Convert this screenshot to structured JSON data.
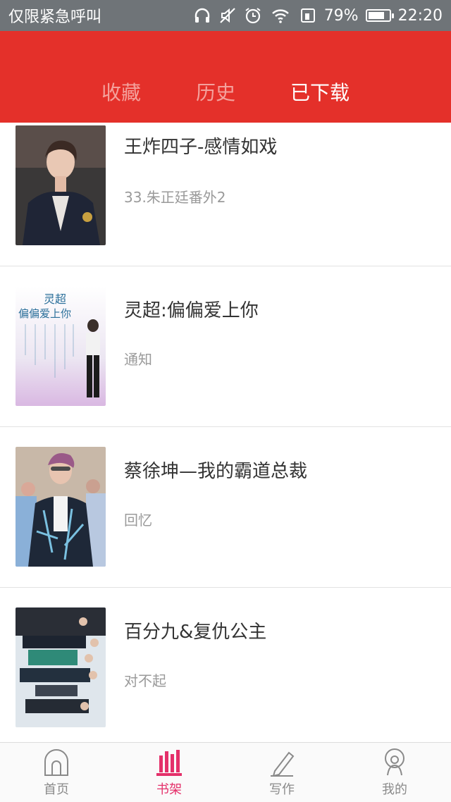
{
  "status_bar": {
    "carrier": "仅限紧急呼叫",
    "battery_pct": "79%",
    "time": "22:20",
    "battery_level": 0.79,
    "icons": [
      "headphones-icon",
      "mute-icon",
      "alarm-icon",
      "wifi-icon",
      "sim-icon",
      "battery-icon"
    ]
  },
  "header": {
    "bg_color": "#e4302a",
    "tabs": [
      {
        "label": "收藏",
        "active": false
      },
      {
        "label": "历史",
        "active": false
      },
      {
        "label": "已下载",
        "active": true
      }
    ]
  },
  "books": [
    {
      "title": "王炸四子-感情如戏",
      "subtitle": "33.朱正廷番外2"
    },
    {
      "title": "灵超:偏偏爱上你",
      "subtitle": "通知",
      "cover_text": [
        "灵超",
        "偏偏爱上你"
      ]
    },
    {
      "title": "蔡徐坤—我的霸道总裁",
      "subtitle": "回忆"
    },
    {
      "title": "百分九&复仇公主",
      "subtitle": "对不起"
    }
  ],
  "bottom_nav": {
    "accent": "#e4306a",
    "items": [
      {
        "label": "首页",
        "icon": "home-arch-icon",
        "active": false
      },
      {
        "label": "书架",
        "icon": "bookshelf-icon",
        "active": true
      },
      {
        "label": "写作",
        "icon": "pencil-icon",
        "active": false
      },
      {
        "label": "我的",
        "icon": "user-icon",
        "active": false
      }
    ]
  }
}
